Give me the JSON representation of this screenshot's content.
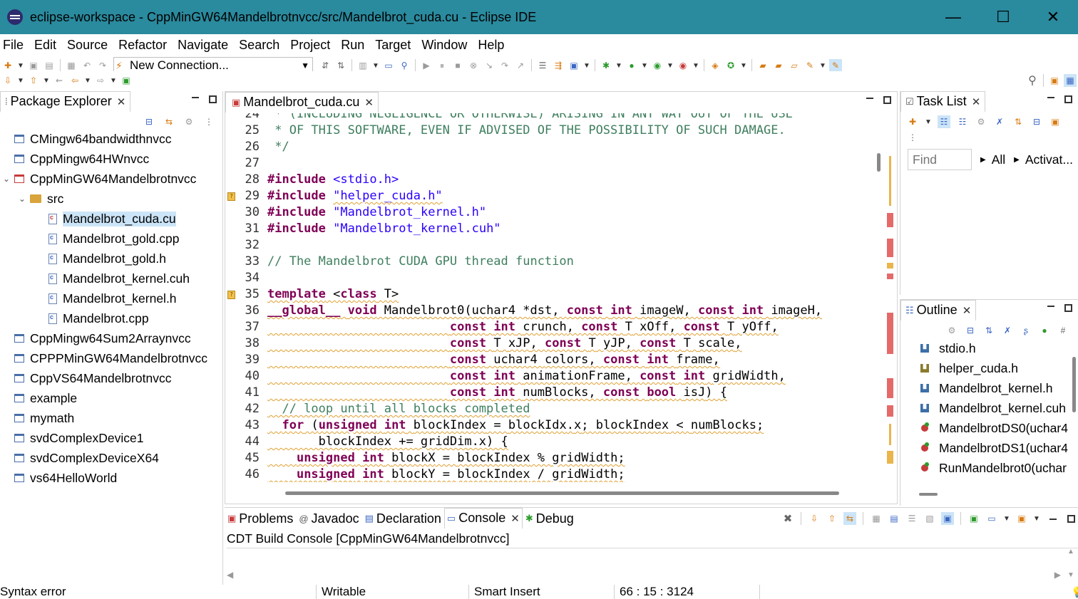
{
  "window": {
    "title": "eclipse-workspace - CppMinGW64Mandelbrotnvcc/src/Mandelbrot_cuda.cu - Eclipse IDE",
    "minimize": "—",
    "maximize": "☐",
    "close": "✕"
  },
  "menu": [
    "File",
    "Edit",
    "Source",
    "Refactor",
    "Navigate",
    "Search",
    "Project",
    "Run",
    "Target",
    "Window",
    "Help"
  ],
  "toolbar": {
    "connection": "New Connection..."
  },
  "package_explorer": {
    "title": "Package Explorer",
    "items": [
      {
        "label": "CMingw64bandwidthnvcc"
      },
      {
        "label": "CppMingw64HWnvcc"
      },
      {
        "label": "CppMinGW64Mandelbrotnvcc"
      },
      {
        "label": "src"
      },
      {
        "label": "Mandelbrot_cuda.cu"
      },
      {
        "label": "Mandelbrot_gold.cpp"
      },
      {
        "label": "Mandelbrot_gold.h"
      },
      {
        "label": "Mandelbrot_kernel.cuh"
      },
      {
        "label": "Mandelbrot_kernel.h"
      },
      {
        "label": "Mandelbrot.cpp"
      },
      {
        "label": "CppMingw64Sum2Arraynvcc"
      },
      {
        "label": "CPPPMinGW64Mandelbrotnvcc"
      },
      {
        "label": "CppVS64Mandelbrotnvcc"
      },
      {
        "label": "example"
      },
      {
        "label": "mymath"
      },
      {
        "label": "svdComplexDevice1"
      },
      {
        "label": "svdComplexDeviceX64"
      },
      {
        "label": "vs64HelloWorld"
      }
    ]
  },
  "editor": {
    "tab": "Mandelbrot_cuda.cu",
    "lines": [
      {
        "n": "24",
        "t": " * (INCLUDING NEGLIGENCE OR OTHERWISE) ARISING IN ANY WAY OUT OF THE USE"
      },
      {
        "n": "25",
        "t": " * OF THIS SOFTWARE, EVEN IF ADVISED OF THE POSSIBILITY OF SUCH DAMAGE."
      },
      {
        "n": "26",
        "t": " */"
      },
      {
        "n": "27",
        "t": ""
      },
      {
        "n": "28",
        "a": "#include",
        "b": " ",
        "c": "<stdio.h>"
      },
      {
        "n": "29",
        "a": "#include",
        "b": " ",
        "c": "\"helper_cuda.h\""
      },
      {
        "n": "30",
        "a": "#include",
        "b": " ",
        "c": "\"Mandelbrot_kernel.h\""
      },
      {
        "n": "31",
        "a": "#include",
        "b": " ",
        "c": "\"Mandelbrot_kernel.cuh\""
      },
      {
        "n": "32",
        "t": ""
      },
      {
        "n": "33",
        "t": "// The Mandelbrot CUDA GPU thread function"
      },
      {
        "n": "34",
        "t": ""
      },
      {
        "n": "35",
        "a": "template",
        "b": " <",
        "c": "class",
        "d": " T>"
      },
      {
        "n": "36",
        "t": "__global__ void Mandelbrot0(uchar4 *dst, const int imageW, const int imageH,"
      },
      {
        "n": "37",
        "t": "                         const int crunch, const T xOff, const T yOff,"
      },
      {
        "n": "38",
        "t": "                         const T xJP, const T yJP, const T scale,"
      },
      {
        "n": "39",
        "t": "                         const uchar4 colors, const int frame,"
      },
      {
        "n": "40",
        "t": "                         const int animationFrame, const int gridWidth,"
      },
      {
        "n": "41",
        "t": "                         const int numBlocks, const bool isJ) {"
      },
      {
        "n": "42",
        "t": "  // loop until all blocks completed"
      },
      {
        "n": "43",
        "t": "  for (unsigned int blockIndex = blockIdx.x; blockIndex < numBlocks;"
      },
      {
        "n": "44",
        "t": "       blockIndex += gridDim.x) {"
      },
      {
        "n": "45",
        "t": "    unsigned int blockX = blockIndex % gridWidth;"
      },
      {
        "n": "46",
        "t": "    unsigned int blockY = blockIndex / gridWidth;"
      }
    ]
  },
  "tasklist": {
    "title": "Task List",
    "find_placeholder": "Find",
    "all": "All",
    "activate": "Activat..."
  },
  "outline": {
    "title": "Outline",
    "items": [
      {
        "label": "stdio.h"
      },
      {
        "label": "helper_cuda.h"
      },
      {
        "label": "Mandelbrot_kernel.h"
      },
      {
        "label": "Mandelbrot_kernel.cuh"
      },
      {
        "label": "MandelbrotDS0(uchar4"
      },
      {
        "label": "MandelbrotDS1(uchar4"
      },
      {
        "label": "RunMandelbrot0(uchar"
      }
    ]
  },
  "console": {
    "tabs": [
      "Problems",
      "Javadoc",
      "Declaration",
      "Console",
      "Debug"
    ],
    "title": "CDT Build Console [CppMinGW64Mandelbrotnvcc]"
  },
  "status": {
    "message": "Syntax error",
    "writable": "Writable",
    "insert": "Smart Insert",
    "position": "66 : 15 : 3124"
  },
  "colors": {
    "titlebar": "#2a8a9e",
    "keyword": "#7f0055",
    "string": "#2a00ff",
    "comment": "#3f7f5f"
  }
}
